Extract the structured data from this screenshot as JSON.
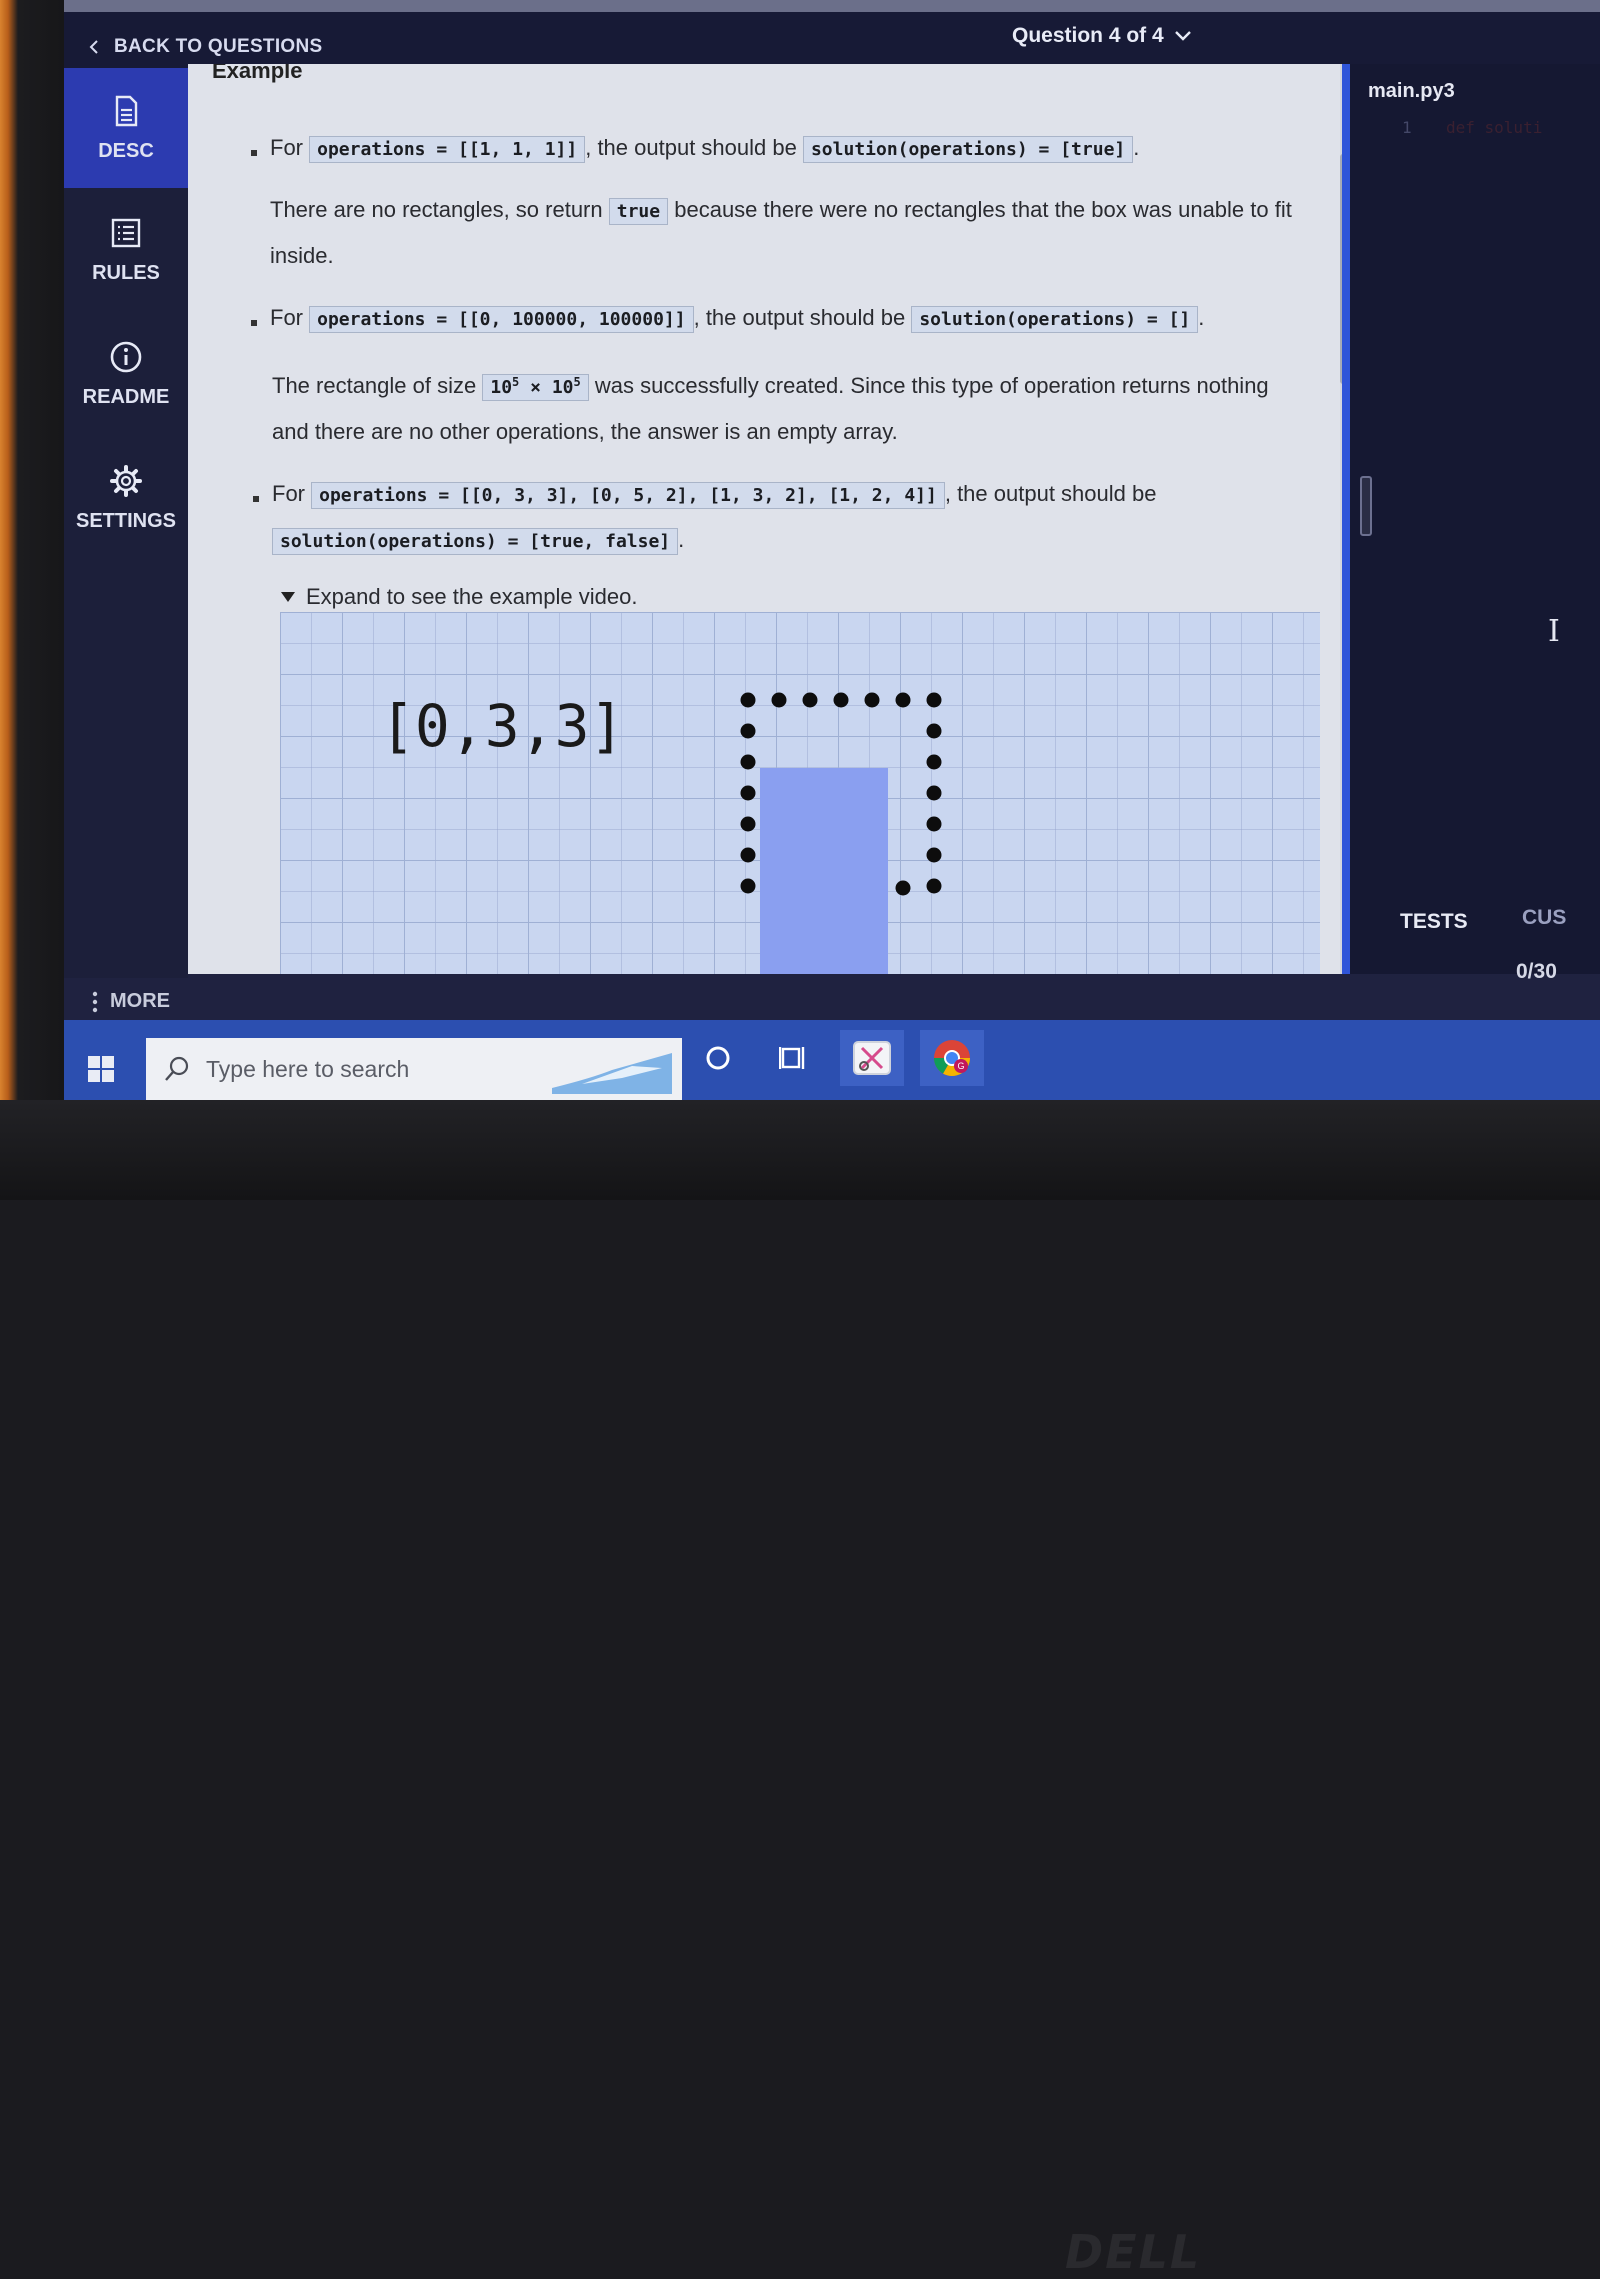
{
  "header": {
    "back_label": "BACK TO QUESTIONS",
    "question_label": "Question 4 of 4"
  },
  "sidebar": {
    "items": [
      {
        "label": "DESC",
        "icon": "document-icon",
        "active": true
      },
      {
        "label": "RULES",
        "icon": "list-icon",
        "active": false
      },
      {
        "label": "README",
        "icon": "info-icon",
        "active": false
      },
      {
        "label": "SETTINGS",
        "icon": "gear-icon",
        "active": false
      }
    ],
    "more_label": "MORE"
  },
  "content": {
    "prev_heading": "Example",
    "examples": [
      {
        "for": "For",
        "input": "operations = [[1, 1, 1]]",
        "mid": ", the output should be",
        "output": "solution(operations) = [true]",
        "end": ".",
        "explain_pre": "There are no rectangles, so return",
        "explain_code": "true",
        "explain_post_line1": "because there were no rectangles that the box was unable to fit",
        "explain_post_line2": "inside."
      },
      {
        "for": "For",
        "input": "operations = [[0, 100000, 100000]]",
        "mid": ", the output should be",
        "output": "solution(operations) = []",
        "end": ".",
        "explain_pre": "The rectangle of size",
        "size_base": "10",
        "size_exp": "5",
        "size_times": "×",
        "explain_post_line1": "was successfully created. Since this type of operation returns nothing",
        "explain_post_line2": "and there are no other operations, the answer is an empty array."
      },
      {
        "for": "For",
        "input": "operations = [[0, 3, 3], [0, 5, 2], [1, 3, 2], [1, 2, 4]]",
        "mid": ", the output should be",
        "output": "solution(operations) = [true, false]",
        "end": "."
      }
    ],
    "expand_label": "Expand to see the example video.",
    "video_operation": "[0,3,3]"
  },
  "editor": {
    "file_tab": "main.py3",
    "line_number": "1",
    "code_line": "def soluti",
    "tests_tab": "TESTS",
    "custom_tab": "CUS",
    "tests_count": "0/30"
  },
  "taskbar": {
    "search_placeholder": "Type here to search",
    "icons": [
      "windows-start-icon",
      "cortana-circle-icon",
      "task-view-icon",
      "snip-tool-icon",
      "chrome-icon"
    ]
  },
  "colors": {
    "accent": "#2c3bb0",
    "sidebar": "#1c1f3a",
    "header": "#171a36",
    "editor": "#151832",
    "taskbar": "#2c4fb0"
  }
}
